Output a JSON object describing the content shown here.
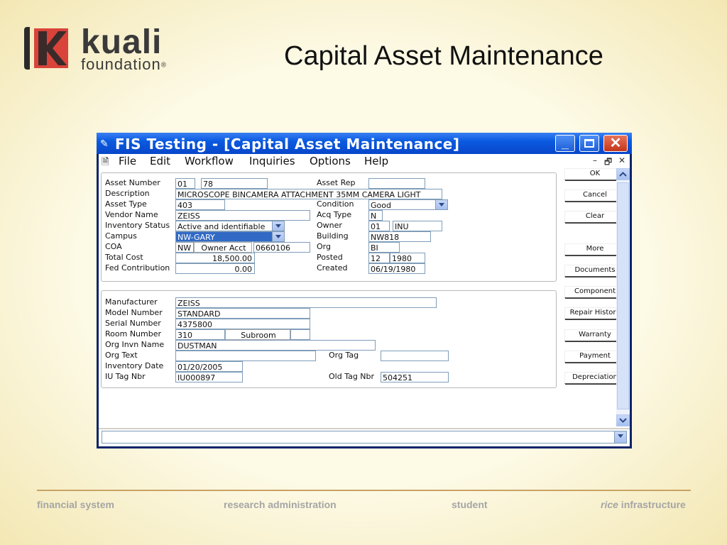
{
  "slide": {
    "title": "Capital Asset Maintenance",
    "logo_word": "kuali",
    "logo_sub": "foundation",
    "logo_reg": "®"
  },
  "window": {
    "title": "FIS Testing - [Capital Asset Maintenance]",
    "minimize_icon": "minimize-icon",
    "maximize_icon": "maximize-icon",
    "close_icon": "close-icon",
    "close_glyph": "✕",
    "min_glyph": "_"
  },
  "menu": {
    "items": [
      "File",
      "Edit",
      "Workflow",
      "Inquiries",
      "Options",
      "Help"
    ],
    "mdi_controls": [
      "–",
      "🗗",
      "✕"
    ]
  },
  "asset": {
    "asset_number_label": "Asset Number",
    "asset_number_prefix": "01",
    "asset_number": "78",
    "description_label": "Description",
    "description": "MICROSCOPE BINCAMERA ATTACHMENT    35MM CAMERA LIGHT",
    "asset_type_label": "Asset Type",
    "asset_type": "403",
    "vendor_name_label": "Vendor Name",
    "vendor_name": "ZEISS",
    "inventory_status_label": "Inventory Status",
    "inventory_status": "Active and identifiable",
    "campus_label": "Campus",
    "campus": "NW-GARY",
    "coa_label": "COA",
    "coa": "NW",
    "owner_acct_label": "Owner Acct",
    "owner_acct": "0660106",
    "total_cost_label": "Total Cost",
    "total_cost": "18,500.00",
    "fed_contribution_label": "Fed Contribution",
    "fed_contribution": "0.00",
    "asset_rep_label": "Asset Rep",
    "asset_rep": "",
    "condition_label": "Condition",
    "condition": "Good",
    "acq_type_label": "Acq Type",
    "acq_type": "N",
    "owner_label": "Owner",
    "owner_code": "01",
    "owner_name": "INU",
    "building_label": "Building",
    "building": "NW818",
    "org_label": "Org",
    "org": "BI",
    "posted_label": "Posted",
    "posted_period": "12",
    "posted_year": "1980",
    "created_label": "Created",
    "created": "06/19/1980"
  },
  "detail": {
    "manufacturer_label": "Manufacturer",
    "manufacturer": "ZEISS",
    "model_number_label": "Model Number",
    "model_number": "STANDARD",
    "serial_number_label": "Serial Number",
    "serial_number": "4375800",
    "room_number_label": "Room Number",
    "room_number": "310",
    "subroom_label": "Subroom",
    "subroom": "",
    "org_invn_name_label": "Org Invn Name",
    "org_invn_name": "DUSTMAN",
    "org_text_label": "Org Text",
    "org_text": "",
    "org_tag_label": "Org Tag",
    "org_tag": "",
    "inventory_date_label": "Inventory Date",
    "inventory_date": "01/20/2005",
    "iu_tag_nbr_label": "IU Tag Nbr",
    "iu_tag_nbr": "IU000897",
    "old_tag_nbr_label": "Old Tag Nbr",
    "old_tag_nbr": "504251"
  },
  "buttons": {
    "ok": "OK",
    "cancel": "Cancel",
    "clear": "Clear",
    "more": "More",
    "documents": "Documents",
    "component": "Component",
    "repair_history": "Repair History",
    "warranty": "Warranty",
    "payment": "Payment",
    "depreciation": "Depreciation"
  },
  "footer": {
    "item1": "financial system",
    "item2": "research administration",
    "item3": "student",
    "item4_italic": "rice",
    "item4_rest": " infrastructure"
  }
}
